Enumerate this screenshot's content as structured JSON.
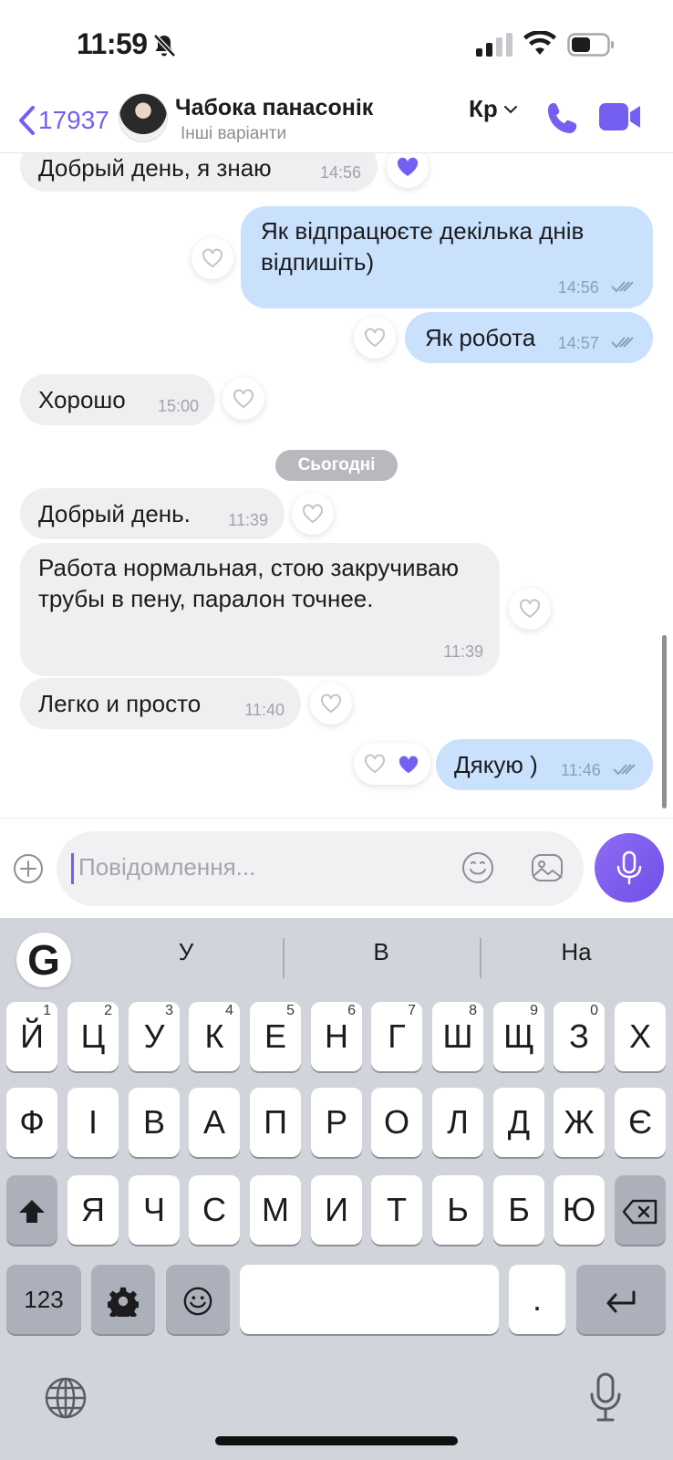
{
  "status_bar": {
    "time": "11:59"
  },
  "header": {
    "back_count": "17937",
    "contact_name": "Чабока панасонік",
    "contact_subtitle": "Інші варіанти",
    "language": "Кр"
  },
  "messages": [
    {
      "dir": "in",
      "text": "Добрый день, я знаю",
      "time": "14:56",
      "reaction": "filled"
    },
    {
      "dir": "out",
      "text": "Як відпрацюєте декілька днів відпишіть)",
      "time": "14:56",
      "reaction": "empty"
    },
    {
      "dir": "out",
      "text": "Як робота",
      "time": "14:57",
      "reaction": "empty"
    },
    {
      "dir": "in",
      "text": "Хорошо",
      "time": "15:00",
      "reaction": "empty"
    },
    {
      "dir": "in",
      "text": "Добрый день.",
      "time": "11:39",
      "reaction": "empty"
    },
    {
      "dir": "in",
      "text": "Работа нормальная, стою закручиваю трубы в пену, паралон точнее.",
      "time": "11:39",
      "reaction": "empty"
    },
    {
      "dir": "in",
      "text": "Легко и просто",
      "time": "11:40",
      "reaction": "empty"
    },
    {
      "dir": "out",
      "text": "Дякую )",
      "time": "11:46",
      "reaction": "empty+filled"
    }
  ],
  "date_separator": "Сьогодні",
  "composer": {
    "placeholder": "Повідомлення..."
  },
  "keyboard": {
    "suggestions": [
      "У",
      "В",
      "На"
    ],
    "row1": [
      "Й",
      "Ц",
      "У",
      "К",
      "Е",
      "Н",
      "Г",
      "Ш",
      "Щ",
      "З",
      "Х"
    ],
    "row1_numbers": [
      "1",
      "2",
      "3",
      "4",
      "5",
      "6",
      "7",
      "8",
      "9",
      "0"
    ],
    "row2": [
      "Ф",
      "І",
      "В",
      "А",
      "П",
      "Р",
      "О",
      "Л",
      "Д",
      "Ж",
      "Є"
    ],
    "row3": [
      "Я",
      "Ч",
      "С",
      "М",
      "И",
      "Т",
      "Ь",
      "Б",
      "Ю"
    ],
    "numbers_key": "123",
    "period_key": "."
  },
  "colors": {
    "accent": "#7360f2",
    "incoming_bubble": "#efeff1",
    "outgoing_bubble": "#c9e1fc",
    "keyboard_bg": "#d1d4db"
  }
}
